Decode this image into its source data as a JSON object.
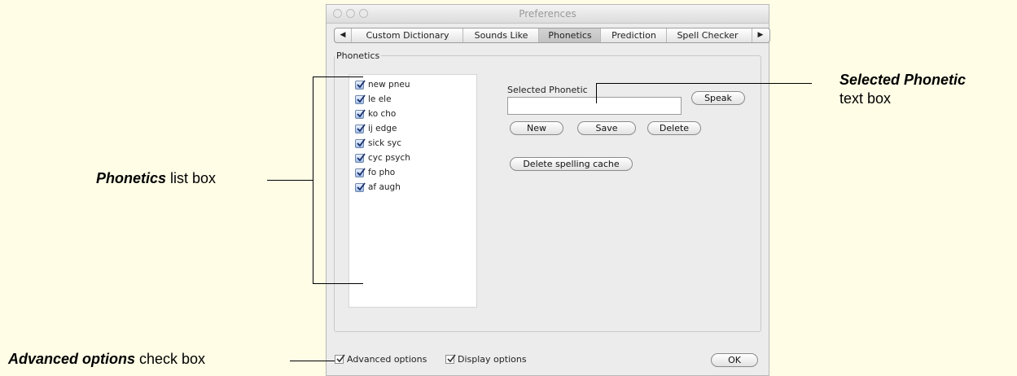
{
  "window": {
    "title": "Preferences"
  },
  "tabs": {
    "scroll_left_icon": "left-triangle",
    "scroll_right_icon": "right-triangle",
    "items": [
      {
        "label": "Custom Dictionary",
        "active": false
      },
      {
        "label": "Sounds Like",
        "active": false
      },
      {
        "label": "Phonetics",
        "active": true
      },
      {
        "label": "Prediction",
        "active": false
      },
      {
        "label": "Spell Checker",
        "active": false
      }
    ]
  },
  "group": {
    "label": "Phonetics"
  },
  "phonetics_list": [
    {
      "label": "new pneu",
      "checked": true
    },
    {
      "label": "le ele",
      "checked": true
    },
    {
      "label": "ko cho",
      "checked": true
    },
    {
      "label": "ij edge",
      "checked": true
    },
    {
      "label": "sick syc",
      "checked": true
    },
    {
      "label": "cyc psych",
      "checked": true
    },
    {
      "label": "fo pho",
      "checked": true
    },
    {
      "label": "af augh",
      "checked": true
    }
  ],
  "selected_phonetic": {
    "label": "Selected Phonetic",
    "value": ""
  },
  "buttons": {
    "speak": "Speak",
    "new": "New",
    "save": "Save",
    "delete": "Delete",
    "delete_cache": "Delete spelling cache",
    "ok": "OK"
  },
  "bottom": {
    "advanced_options": {
      "label": "Advanced options",
      "checked": true
    },
    "display_options": {
      "label": "Display options",
      "checked": true
    }
  },
  "callouts": {
    "selected_phonetic": {
      "bold": "Selected Phonetic",
      "rest": "text box"
    },
    "phonetics_list": {
      "bold": "Phonetics",
      "rest": " list box"
    },
    "advanced_options": {
      "bold": "Advanced options",
      "rest": " check box"
    }
  },
  "colors": {
    "background": "#fffde6",
    "window": "#ececec",
    "accent_check": "#9fbde8"
  }
}
